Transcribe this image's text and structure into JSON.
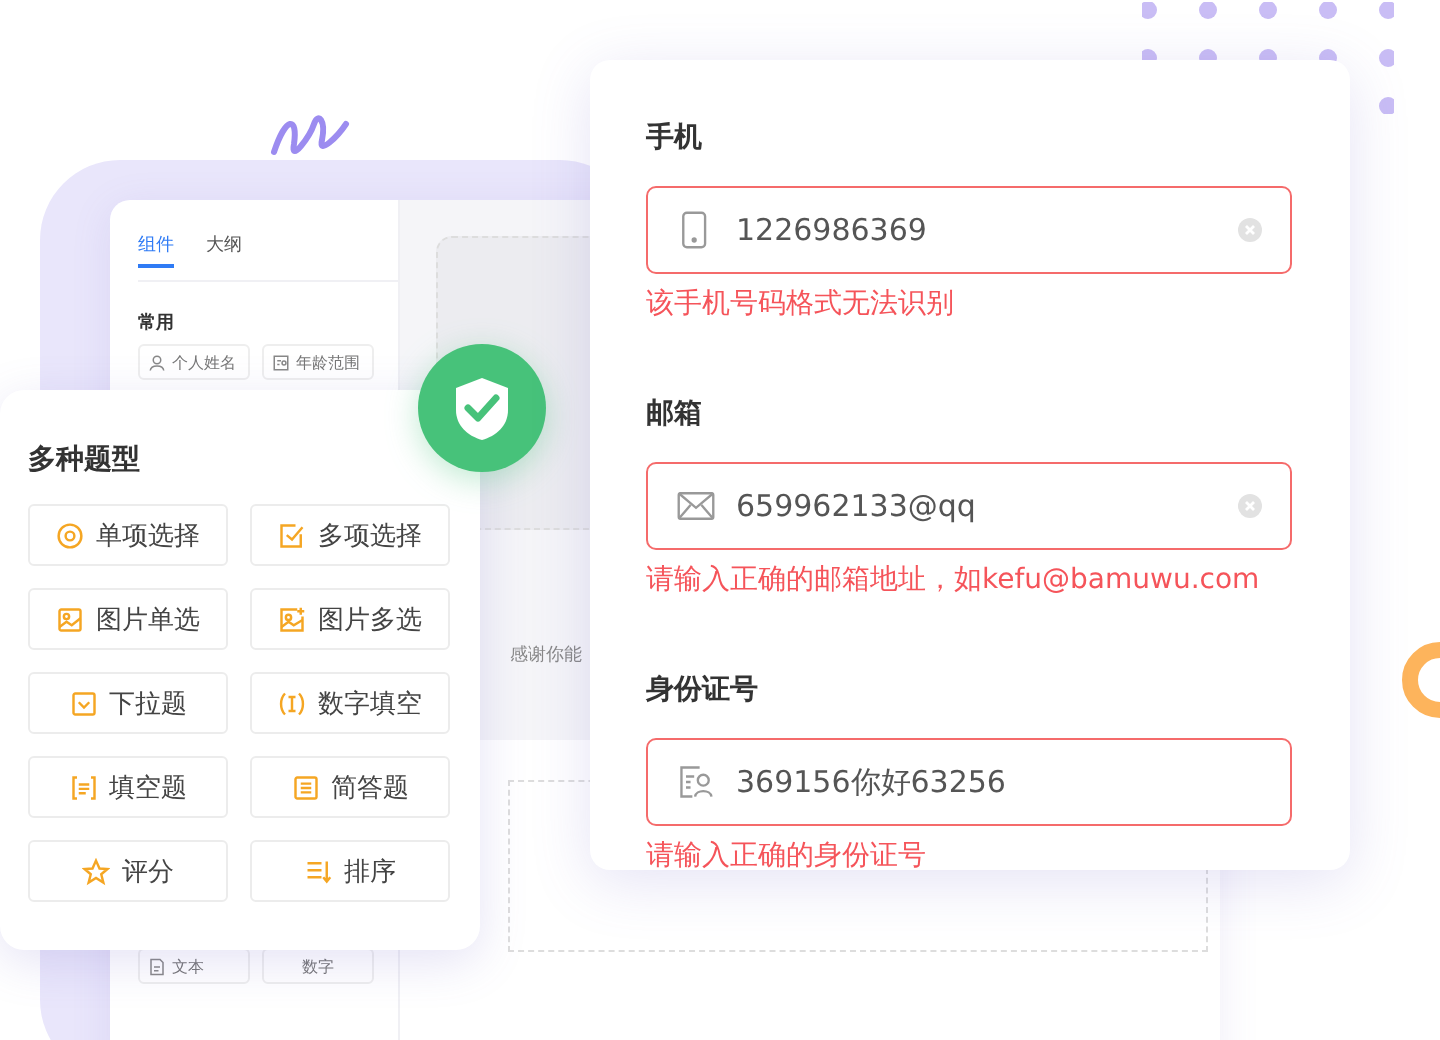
{
  "builder": {
    "tabs": [
      {
        "label": "组件",
        "selected": true
      },
      {
        "label": "大纲",
        "selected": false
      }
    ],
    "section": "常用",
    "components": [
      {
        "label": "个人姓名",
        "kind": "person"
      },
      {
        "label": "年龄范围",
        "kind": "card"
      }
    ],
    "components_bottom": [
      {
        "label": "文本",
        "kind": "doc"
      },
      {
        "label": "数字",
        "kind": "none"
      }
    ],
    "canvas_text": "感谢你能"
  },
  "question_types": {
    "title": "多种题型",
    "items": [
      {
        "label": "单项选择",
        "kind": "radio"
      },
      {
        "label": "多项选择",
        "kind": "checkbox"
      },
      {
        "label": "图片单选",
        "kind": "image"
      },
      {
        "label": "图片多选",
        "kind": "image-multi"
      },
      {
        "label": "下拉题",
        "kind": "dropdown"
      },
      {
        "label": "数字填空",
        "kind": "number"
      },
      {
        "label": "填空题",
        "kind": "blank"
      },
      {
        "label": "简答题",
        "kind": "text"
      },
      {
        "label": "评分",
        "kind": "star"
      },
      {
        "label": "排序",
        "kind": "sort"
      }
    ]
  },
  "form": {
    "fields": [
      {
        "label": "手机",
        "kind": "phone",
        "value": "1226986369",
        "error": "该手机号码格式无法识别",
        "clearable": true,
        "invalid": true
      },
      {
        "label": "邮箱",
        "kind": "email",
        "value": "659962133@qq",
        "error": "请输入正确的邮箱地址，如kefu@bamuwu.com",
        "clearable": true,
        "invalid": true
      },
      {
        "label": "身份证号",
        "kind": "id",
        "value": "369156你好63256",
        "error": "请输入正确的身份证号",
        "clearable": false,
        "invalid": true
      }
    ]
  }
}
